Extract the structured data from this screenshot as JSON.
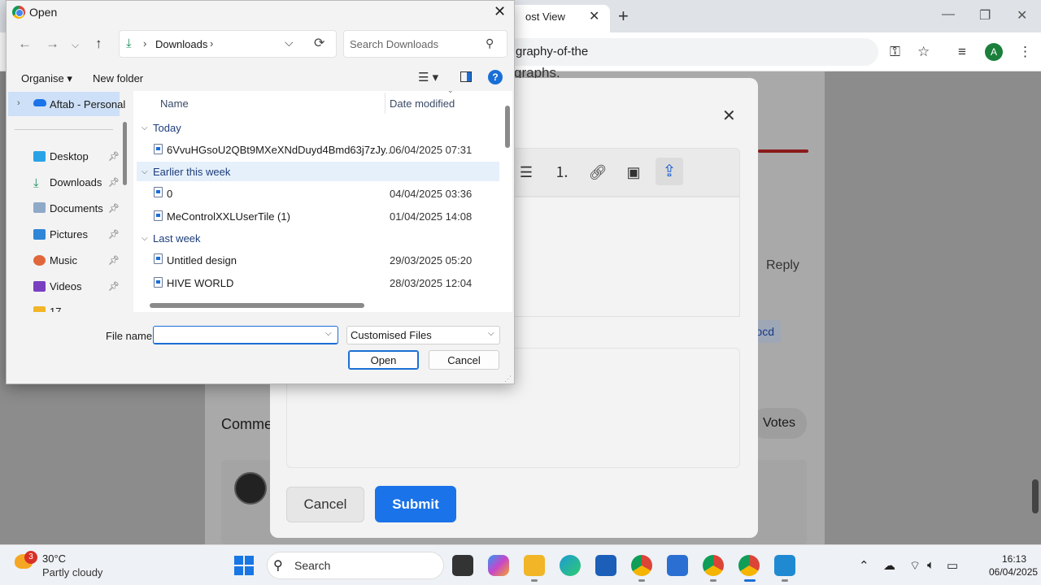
{
  "browser": {
    "tab_title": "ost View",
    "url_fragment": "graphy-of-the",
    "avatar_initial": "A"
  },
  "page": {
    "paragraph_fragment": "graphs.",
    "comments_heading": "Comme",
    "votes_label": "Votes",
    "reply_label": "Reply",
    "tag_fragment": "ocd"
  },
  "editor_modal": {
    "cancel_label": "Cancel",
    "submit_label": "Submit",
    "submit_color": "#1a73e8"
  },
  "dialog": {
    "title": "Open",
    "path": {
      "location": "Downloads"
    },
    "search_placeholder": "Search Downloads",
    "commands": {
      "organise": "Organise",
      "new_folder": "New folder"
    },
    "nav": {
      "items": [
        {
          "label": "Aftab - Personal",
          "icon": "onedrive-icon"
        },
        {
          "label": "Desktop",
          "icon": "desktop-icon",
          "pinned": true
        },
        {
          "label": "Downloads",
          "icon": "download-icon",
          "pinned": true
        },
        {
          "label": "Documents",
          "icon": "documents-icon",
          "pinned": true
        },
        {
          "label": "Pictures",
          "icon": "pictures-icon",
          "pinned": true
        },
        {
          "label": "Music",
          "icon": "music-icon",
          "pinned": true
        },
        {
          "label": "Videos",
          "icon": "videos-icon",
          "pinned": true
        },
        {
          "label": "17",
          "icon": "folder-icon"
        }
      ]
    },
    "columns": {
      "name": "Name",
      "date": "Date modified"
    },
    "groups": [
      {
        "label": "Today",
        "files": [
          {
            "name": "6VvuHGsoU2QBt9MXeXNdDuyd4Bmd63j7zJy...",
            "date": "06/04/2025 07:31"
          }
        ]
      },
      {
        "label": "Earlier this week",
        "files": [
          {
            "name": "0",
            "date": "04/04/2025 03:36"
          },
          {
            "name": "MeControlXXLUserTile (1)",
            "date": "01/04/2025 14:08"
          }
        ]
      },
      {
        "label": "Last week",
        "files": [
          {
            "name": "Untitled design",
            "date": "29/03/2025 05:20"
          },
          {
            "name": "HIVE WORLD",
            "date": "28/03/2025 12:04"
          }
        ]
      }
    ],
    "file_name_label": "File name:",
    "file_name_value": "",
    "file_type": "Customised Files",
    "open_label": "Open",
    "cancel_label": "Cancel"
  },
  "taskbar": {
    "weather_badge": "3",
    "weather_temp": "30°C",
    "weather_desc": "Partly cloudy",
    "search_label": "Search",
    "time": "16:13",
    "date": "06/04/2025"
  }
}
